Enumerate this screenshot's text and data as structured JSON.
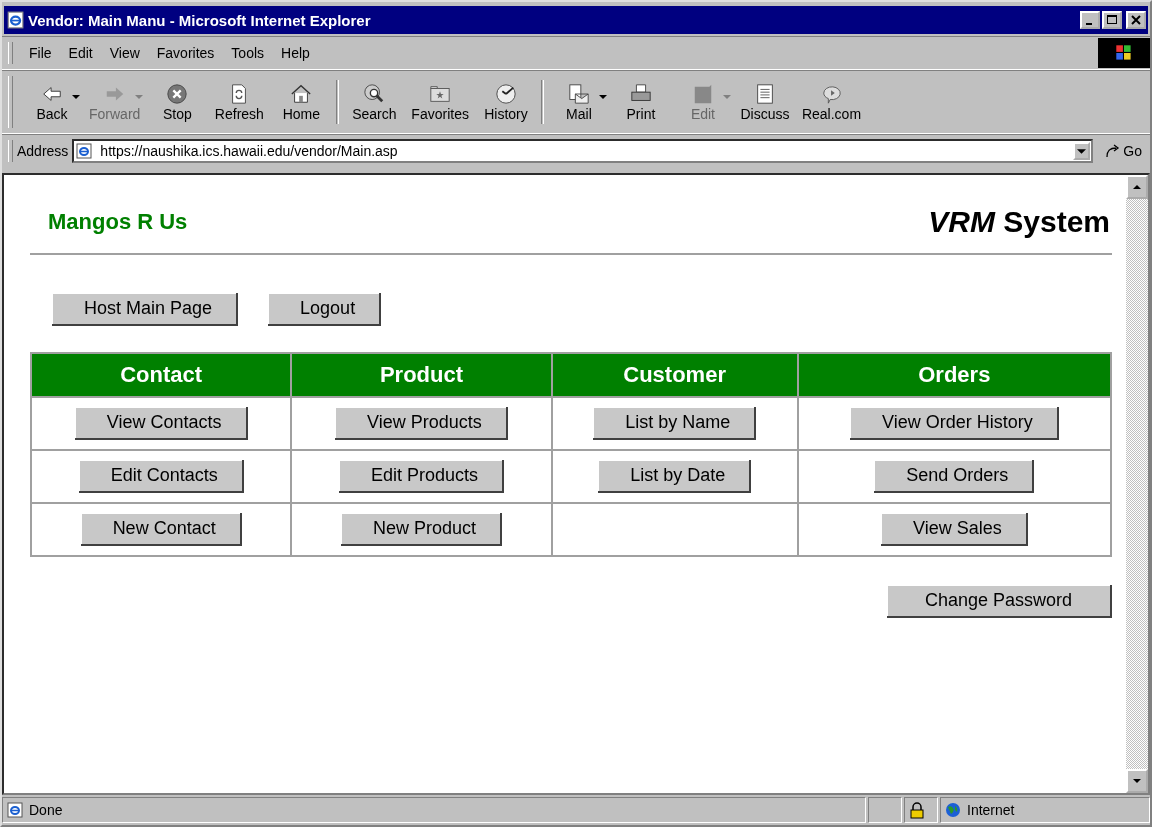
{
  "window": {
    "title": "Vendor: Main Manu - Microsoft Internet Explorer"
  },
  "menu": [
    "File",
    "Edit",
    "View",
    "Favorites",
    "Tools",
    "Help"
  ],
  "toolbar": [
    {
      "label": "Back",
      "disabled": false,
      "dropdown": true
    },
    {
      "label": "Forward",
      "disabled": true,
      "dropdown": true
    },
    {
      "label": "Stop",
      "disabled": false,
      "dropdown": false
    },
    {
      "label": "Refresh",
      "disabled": false,
      "dropdown": false
    },
    {
      "label": "Home",
      "disabled": false,
      "dropdown": false
    },
    {
      "label": "Search",
      "disabled": false,
      "dropdown": false
    },
    {
      "label": "Favorites",
      "disabled": false,
      "dropdown": false
    },
    {
      "label": "History",
      "disabled": false,
      "dropdown": false
    },
    {
      "label": "Mail",
      "disabled": false,
      "dropdown": true
    },
    {
      "label": "Print",
      "disabled": false,
      "dropdown": false
    },
    {
      "label": "Edit",
      "disabled": true,
      "dropdown": true
    },
    {
      "label": "Discuss",
      "disabled": false,
      "dropdown": false
    },
    {
      "label": "Real.com",
      "disabled": false,
      "dropdown": false
    }
  ],
  "address": {
    "label": "Address",
    "value": "https://naushika.ics.hawaii.edu/vendor/Main.asp",
    "go": "Go"
  },
  "page": {
    "brand": "Mangos R Us",
    "system": "*VRM* System",
    "top_buttons": [
      "Host Main Page",
      "Logout"
    ],
    "table": {
      "columns": [
        "Contact",
        "Product",
        "Customer",
        "Orders"
      ],
      "rows": [
        [
          "View Contacts",
          "View Products",
          "List by Name",
          "View Order History"
        ],
        [
          "Edit Contacts",
          "Edit Products",
          "List by Date",
          "Send Orders"
        ],
        [
          "New Contact",
          "New Product",
          null,
          "View Sales"
        ]
      ]
    },
    "bottom_button": "Change Password"
  },
  "status_bar": {
    "text": "Done",
    "secure": true,
    "zone": "Internet"
  }
}
